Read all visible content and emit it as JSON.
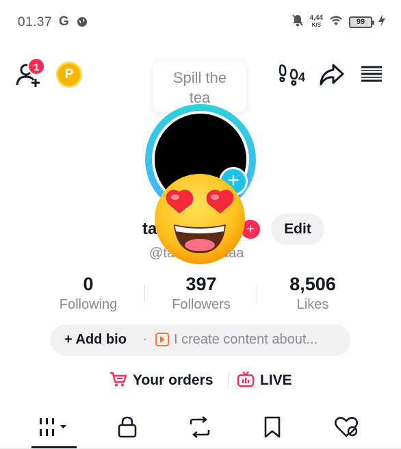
{
  "status_bar": {
    "time": "01.37",
    "g_label": "G",
    "net_speed": "4,44",
    "net_unit": "K/S",
    "battery": "99"
  },
  "header": {
    "notification_count": "1",
    "coin_label": "P",
    "footprint_count": "4",
    "tooltip_line1": "Spill the",
    "tooltip_line2": "tea"
  },
  "profile": {
    "name_visible": "ta",
    "edit_label": "Edit",
    "handle_start": "@ta",
    "handle_end": "aaa"
  },
  "stats": [
    {
      "value": "0",
      "label": "Following"
    },
    {
      "value": "397",
      "label": "Followers"
    },
    {
      "value": "8,506",
      "label": "Likes"
    }
  ],
  "bio": {
    "add_label": "+ Add bio",
    "separator": "·",
    "hint": "I create content about..."
  },
  "links": {
    "orders_label": "Your orders",
    "live_label": "LIVE"
  },
  "colors": {
    "accent": "#fe2c55",
    "ring": "#2fd3d8",
    "muted": "#8a8b91"
  },
  "tabs": [
    {
      "icon": "grid-icon"
    },
    {
      "icon": "lock-icon"
    },
    {
      "icon": "repost-icon"
    },
    {
      "icon": "bookmark-icon"
    },
    {
      "icon": "liked-heart-icon"
    }
  ]
}
